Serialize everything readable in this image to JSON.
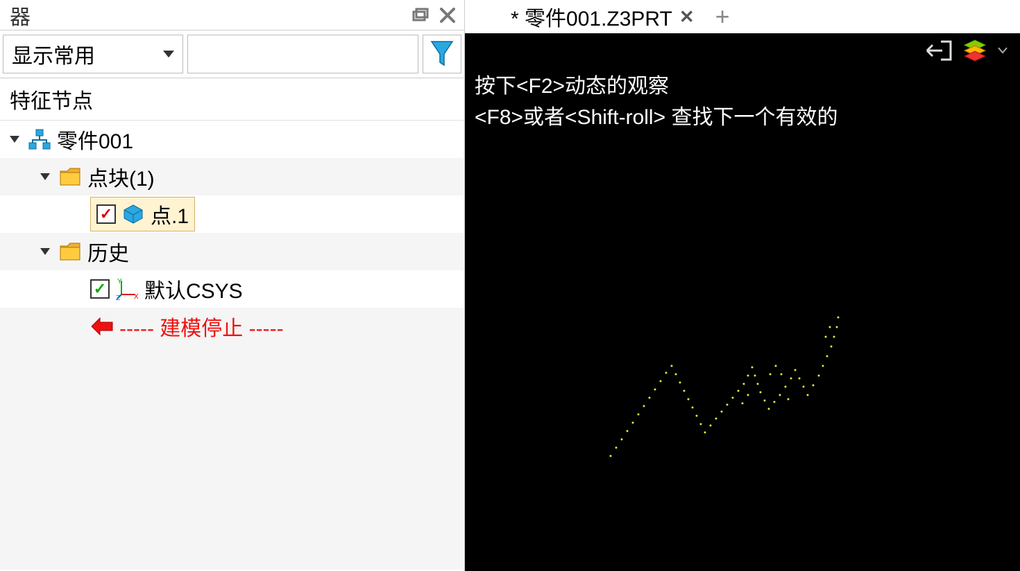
{
  "panel": {
    "title_fragment": "器",
    "dropdown_label": "显示常用",
    "section_header": "特征节点"
  },
  "tree": {
    "root": {
      "label": "零件001"
    },
    "group1": {
      "label": "点块(1)"
    },
    "point1": {
      "label": "点.1"
    },
    "group2": {
      "label": "历史"
    },
    "csys": {
      "label": "默认CSYS"
    },
    "stop": {
      "label": "----- 建模停止 -----"
    }
  },
  "tab": {
    "label": "* 零件001.Z3PRT"
  },
  "viewport": {
    "hint_line1": "按下<F2>动态的观察",
    "hint_line2": "<F8>或者<Shift-roll> 查找下一个有效的"
  },
  "icons": {
    "funnel": "filter-icon",
    "hierarchy": "hierarchy-icon",
    "folder": "folder-icon",
    "cube": "cube-icon",
    "csys": "csys-icon",
    "arrow_left": "arrow-left-icon",
    "restore": "restore-window-icon",
    "close": "close-window-icon",
    "exit": "exit-icon",
    "layers": "layers-icon"
  }
}
